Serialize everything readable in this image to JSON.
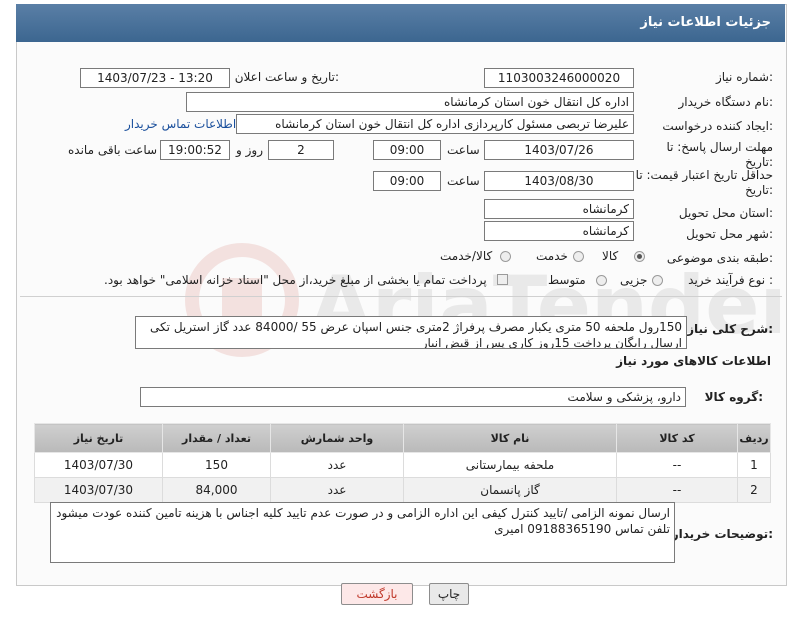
{
  "header": {
    "title": "جزئیات اطلاعات نیاز"
  },
  "fields": {
    "need_number": {
      "label": "شماره نیاز:",
      "value": "1103003246000020"
    },
    "announce_datetime": {
      "label": "تاریخ و ساعت اعلان عمومی:",
      "value": "1403/07/23 - 13:20"
    },
    "buyer_org": {
      "label": "نام دستگاه خریدار:",
      "value": "اداره کل انتقال خون استان کرمانشاه"
    },
    "requester": {
      "label": "ایجاد کننده درخواست:",
      "value": "علیرضا تربصی مسئول کارپردازی اداره کل انتقال خون استان کرمانشاه",
      "contact_link": "اطلاعات تماس خریدار"
    },
    "reply_deadline": {
      "label": "مهلت ارسال پاسخ: تا تاریخ:",
      "date": "1403/07/26",
      "time_label": "ساعت",
      "time": "09:00",
      "days": "2",
      "days_label": "روز و",
      "remaining": "19:00:52",
      "remaining_label": "ساعت باقی مانده"
    },
    "price_validity": {
      "label": "حداقل تاریخ اعتبار قیمت: تا تاریخ:",
      "date": "1403/08/30",
      "time_label": "ساعت",
      "time": "09:00"
    },
    "delivery_province": {
      "label": "استان محل تحویل:",
      "value": "کرمانشاه"
    },
    "delivery_city": {
      "label": "شهر محل تحویل:",
      "value": "کرمانشاه"
    },
    "category": {
      "label": "طبقه بندی موضوعی:",
      "options": [
        "کالا",
        "خدمت",
        "کالا/خدمت"
      ],
      "selected": "کالا"
    },
    "process": {
      "label": "نوع فرآیند خرید :",
      "options": [
        "جزیی",
        "متوسط"
      ],
      "selected": "جزیی",
      "note": "پرداخت تمام یا بخشی از مبلغ خرید،از محل \"اسناد خزانه اسلامی\" خواهد بود."
    }
  },
  "description": {
    "label": "شرح کلی نیاز:",
    "text": "150رول ملحفه 50 متری یکبار مصرف پرفراژ 2متری جنس اسپان عرض 55 /84000 عدد گاز استریل تکی ارسال رایگان پرداخت 15روز کاری پس از قبض انبار"
  },
  "goods_section": {
    "title": "اطلاعات کالاهای مورد نیاز",
    "group_label": "گروه کالا:",
    "group_value": "دارو، پزشکی و سلامت"
  },
  "table": {
    "headers": [
      "ردیف",
      "کد کالا",
      "نام کالا",
      "واحد شمارش",
      "تعداد / مقدار",
      "تاریخ نیاز"
    ],
    "rows": [
      [
        "1",
        "--",
        "ملحفه بیمارستانی",
        "عدد",
        "150",
        "1403/07/30"
      ],
      [
        "2",
        "--",
        "گاز پانسمان",
        "عدد",
        "84,000",
        "1403/07/30"
      ]
    ]
  },
  "buyer_notes": {
    "label": "توضیحات خریدار:",
    "text": "ارسال نمونه الزامی /تایید کنترل کیفی این اداره الزامی و در صورت عدم تایید کلیه اجناس با هزینه تامین کننده عودت میشود تلفن تماس 09188365190 امیری"
  },
  "buttons": {
    "print": "چاپ",
    "back": "بازگشت"
  },
  "colors": {
    "header_bg": "#4a729b",
    "back_button_bg": "#fde8e8",
    "print_button_bg": "#e9e9e9"
  }
}
